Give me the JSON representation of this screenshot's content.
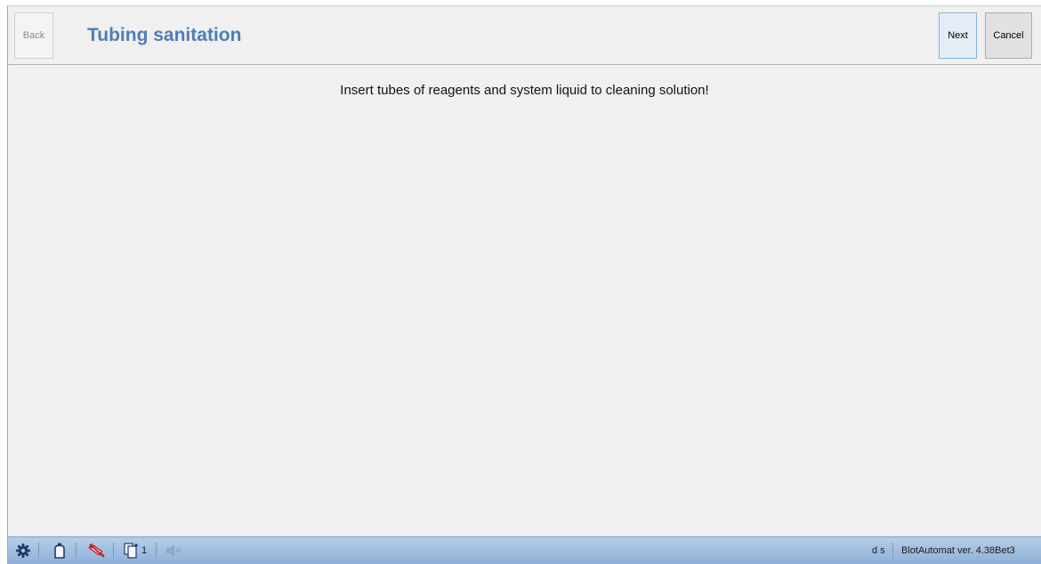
{
  "header": {
    "back_label": "Back",
    "title": "Tubing sanitation",
    "next_label": "Next",
    "cancel_label": "Cancel"
  },
  "main": {
    "message": "Insert tubes of reagents and system liquid to cleaning solution!"
  },
  "statusbar": {
    "icons": [
      "gear-icon",
      "bottle-icon",
      "syringe-disabled-icon",
      "documents-icon",
      "speaker-muted-icon"
    ],
    "documents_count": "1",
    "user_initials": "d s",
    "version_text": "BlotAutomat ver. 4.38Bet3"
  },
  "colors": {
    "title": "#4f7db8",
    "background": "#f0f0f0",
    "statusbar": "#9fbde0",
    "syringe_red": "#c0202c",
    "icon_dark": "#1f3b63"
  }
}
